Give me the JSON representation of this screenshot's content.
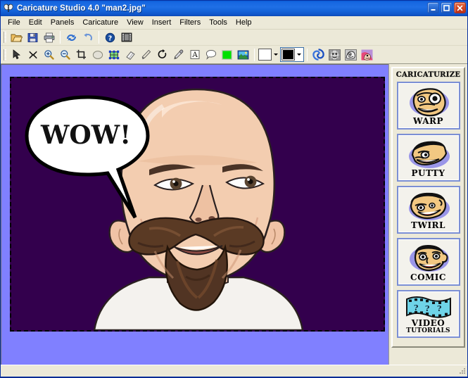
{
  "window": {
    "app_title": "Caricature Studio 4.0",
    "document_title": "\"man2.jpg\"",
    "title_full": "Caricature Studio 4.0   \"man2.jpg\"",
    "icon": "butterfly-app-icon",
    "controls": {
      "minimize": "minimize-button",
      "maximize": "maximize-button",
      "close": "close-button"
    }
  },
  "menu": {
    "items": [
      {
        "label": "File"
      },
      {
        "label": "Edit"
      },
      {
        "label": "Panels"
      },
      {
        "label": "Caricature"
      },
      {
        "label": "View"
      },
      {
        "label": "Insert"
      },
      {
        "label": "Filters"
      },
      {
        "label": "Tools"
      },
      {
        "label": "Help"
      }
    ]
  },
  "toolbar_file": {
    "buttons": [
      {
        "name": "open-file-button",
        "icon": "folder-open-icon",
        "tooltip": "Open"
      },
      {
        "name": "save-file-button",
        "icon": "floppy-disk-icon",
        "tooltip": "Save"
      },
      {
        "name": "print-button",
        "icon": "printer-icon",
        "tooltip": "Print"
      },
      {
        "name": "undo-button",
        "icon": "undo-arrows-icon",
        "tooltip": "Undo"
      },
      {
        "name": "redo-button",
        "icon": "redo-arrow-icon",
        "tooltip": "Redo"
      },
      {
        "name": "help-button",
        "icon": "question-mark-icon",
        "tooltip": "Help"
      },
      {
        "name": "movie-button",
        "icon": "film-strip-icon",
        "tooltip": "Movie"
      }
    ]
  },
  "toolbar_tools": {
    "buttons": [
      {
        "name": "select-tool",
        "icon": "arrow-cursor-icon",
        "tooltip": "Select"
      },
      {
        "name": "delete-tool",
        "icon": "x-scissors-icon",
        "tooltip": "Delete"
      },
      {
        "name": "zoom-in-tool",
        "icon": "magnifier-plus-icon",
        "tooltip": "Zoom In"
      },
      {
        "name": "zoom-out-tool",
        "icon": "magnifier-minus-icon",
        "tooltip": "Zoom Out"
      },
      {
        "name": "crop-tool",
        "icon": "crop-icon",
        "tooltip": "Crop"
      },
      {
        "name": "ellipse-tool",
        "icon": "ellipse-icon",
        "tooltip": "Ellipse"
      },
      {
        "name": "mesh-warp-tool",
        "icon": "mesh-handles-icon",
        "tooltip": "Warp Mesh"
      },
      {
        "name": "eraser-tool",
        "icon": "eraser-icon",
        "tooltip": "Eraser"
      },
      {
        "name": "brush-tool",
        "icon": "paintbrush-icon",
        "tooltip": "Brush"
      },
      {
        "name": "rotate-tool",
        "icon": "rotate-arrow-icon",
        "tooltip": "Rotate"
      },
      {
        "name": "eyedropper-tool",
        "icon": "eyedropper-icon",
        "tooltip": "Eyedropper"
      },
      {
        "name": "text-tool",
        "icon": "text-a-icon",
        "tooltip": "Text"
      },
      {
        "name": "speech-bubble-tool",
        "icon": "speech-bubble-icon",
        "tooltip": "Speech Bubble"
      },
      {
        "name": "fill-color-tool",
        "icon": "green-swatch-icon",
        "tooltip": "Fill Color"
      },
      {
        "name": "image-tool",
        "icon": "picture-icon",
        "tooltip": "Insert Image"
      }
    ],
    "shape_dropdown": {
      "name": "shape-picker",
      "icon": "white-square-icon",
      "value": "square"
    },
    "color_dropdown": {
      "name": "color-picker",
      "icon": "black-swatch-icon",
      "value": "#000000",
      "selected": true
    },
    "effects": [
      {
        "name": "swirl-effect-button",
        "icon": "blue-swirl-icon"
      },
      {
        "name": "face-grid-button",
        "icon": "face-mesh-icon"
      },
      {
        "name": "face-morph-button",
        "icon": "face-circle-icon"
      },
      {
        "name": "caricature-sample-button",
        "icon": "pink-caricature-icon"
      }
    ]
  },
  "colors": {
    "title_bar": "#1f6fe6",
    "chrome": "#ece9d8",
    "workspace": "#8080ff",
    "canvas_bg": "#33004d",
    "accent_blue": "#7b8fd4",
    "fill_green": "#00e000",
    "close_red": "#d44a26"
  },
  "canvas": {
    "name": "image-canvas",
    "background_color": "#33004d",
    "speech_bubble": {
      "name": "speech-bubble",
      "text": "WOW!"
    },
    "subject": "bald-man-caricature-with-mustache-and-goatee"
  },
  "right_panel": {
    "title": "CARICATURIZE",
    "buttons": [
      {
        "name": "warp-button",
        "label": "WARP",
        "icon": "warp-face-icon"
      },
      {
        "name": "putty-button",
        "label": "PUTTY",
        "icon": "putty-face-icon"
      },
      {
        "name": "twirl-button",
        "label": "TWIRL",
        "icon": "twirl-face-icon"
      },
      {
        "name": "comic-button",
        "label": "COMIC",
        "icon": "comic-face-icon"
      },
      {
        "name": "video-tutorials-button",
        "label": "VIDEO",
        "label2": "TUTORIALS",
        "icon": "film-strip-tutorials-icon"
      }
    ]
  },
  "statusbar": {
    "text": ""
  }
}
